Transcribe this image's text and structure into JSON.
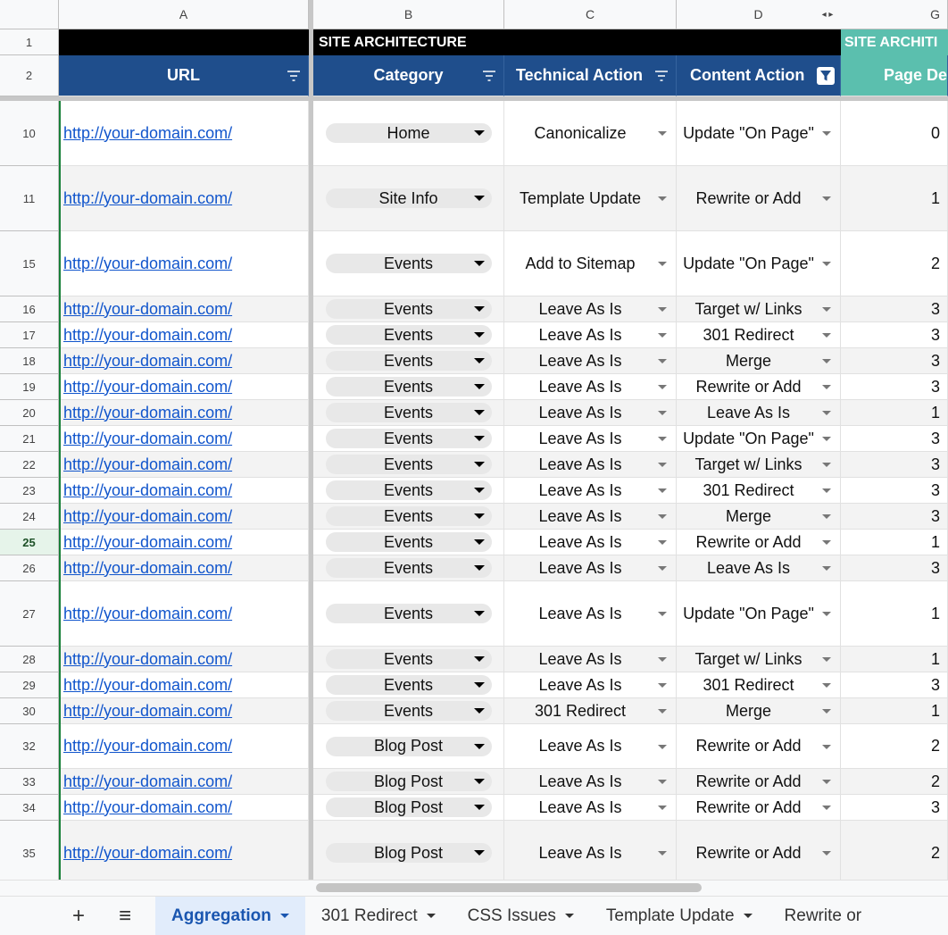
{
  "colors": {
    "header_blue": "#1f4e8c",
    "header_teal": "#5bbfae",
    "band_black": "#000000",
    "link": "#1155cc",
    "active_tab_bg": "#e1ecfb"
  },
  "columns": {
    "row_corner": "",
    "A": "A",
    "B": "B",
    "C": "C",
    "D": "D",
    "G": "G",
    "scroll_left": "◂",
    "scroll_right": "▸"
  },
  "band": {
    "row": "1",
    "label1": "SITE ARCHITECTURE",
    "label2": "SITE ARCHITI"
  },
  "headers": {
    "row": "2",
    "url": "URL",
    "category": "Category",
    "technical": "Technical Action",
    "content": "Content Action",
    "depth": "Page De"
  },
  "rows": [
    {
      "n": "10",
      "url": "http://your-domain.com/",
      "category": "Home",
      "technical": "Canonicalize",
      "content": "Update \"On Page\"",
      "depth": "0",
      "tall": true
    },
    {
      "n": "11",
      "url": "http://your-domain.com/",
      "category": "Site Info",
      "technical": "Template Update",
      "content": "Rewrite or Add",
      "depth": "1",
      "tall": true
    },
    {
      "n": "15",
      "url": "http://your-domain.com/",
      "category": "Events",
      "technical": "Add to Sitemap",
      "content": "Update \"On Page\"",
      "depth": "2",
      "tall": true
    },
    {
      "n": "16",
      "url": "http://your-domain.com/",
      "category": "Events",
      "technical": "Leave As Is",
      "content": "Target w/ Links",
      "depth": "3"
    },
    {
      "n": "17",
      "url": "http://your-domain.com/",
      "category": "Events",
      "technical": "Leave As Is",
      "content": "301 Redirect",
      "depth": "3"
    },
    {
      "n": "18",
      "url": "http://your-domain.com/",
      "category": "Events",
      "technical": "Leave As Is",
      "content": "Merge",
      "depth": "3"
    },
    {
      "n": "19",
      "url": "http://your-domain.com/",
      "category": "Events",
      "technical": "Leave As Is",
      "content": "Rewrite or Add",
      "depth": "3"
    },
    {
      "n": "20",
      "url": "http://your-domain.com/",
      "category": "Events",
      "technical": "Leave As Is",
      "content": "Leave As Is",
      "depth": "1"
    },
    {
      "n": "21",
      "url": "http://your-domain.com/",
      "category": "Events",
      "technical": "Leave As Is",
      "content": "Update \"On Page\"",
      "depth": "3"
    },
    {
      "n": "22",
      "url": "http://your-domain.com/",
      "category": "Events",
      "technical": "Leave As Is",
      "content": "Target w/ Links",
      "depth": "3"
    },
    {
      "n": "23",
      "url": "http://your-domain.com/",
      "category": "Events",
      "technical": "Leave As Is",
      "content": "301 Redirect",
      "depth": "3"
    },
    {
      "n": "24",
      "url": "http://your-domain.com/",
      "category": "Events",
      "technical": "Leave As Is",
      "content": "Merge",
      "depth": "3"
    },
    {
      "n": "25",
      "url": "http://your-domain.com/",
      "category": "Events",
      "technical": "Leave As Is",
      "content": "Rewrite or Add",
      "depth": "1",
      "active": true
    },
    {
      "n": "26",
      "url": "http://your-domain.com/",
      "category": "Events",
      "technical": "Leave As Is",
      "content": "Leave As Is",
      "depth": "3"
    },
    {
      "n": "27",
      "url": "http://your-domain.com/",
      "category": "Events",
      "technical": "Leave As Is",
      "content": "Update \"On Page\"",
      "depth": "1",
      "tall": true
    },
    {
      "n": "28",
      "url": "http://your-domain.com/",
      "category": "Events",
      "technical": "Leave As Is",
      "content": "Target w/ Links",
      "depth": "1"
    },
    {
      "n": "29",
      "url": "http://your-domain.com/",
      "category": "Events",
      "technical": "Leave As Is",
      "content": "301 Redirect",
      "depth": "3"
    },
    {
      "n": "30",
      "url": "http://your-domain.com/",
      "category": "Events",
      "technical": "301 Redirect",
      "content": "Merge",
      "depth": "1"
    },
    {
      "n": "32",
      "url": "http://your-domain.com/",
      "category": "Blog Post",
      "technical": "Leave As Is",
      "content": "Rewrite or Add",
      "depth": "2",
      "medium": true
    },
    {
      "n": "33",
      "url": "http://your-domain.com/",
      "category": "Blog Post",
      "technical": "Leave As Is",
      "content": "Rewrite or Add",
      "depth": "2"
    },
    {
      "n": "34",
      "url": "http://your-domain.com/",
      "category": "Blog Post",
      "technical": "Leave As Is",
      "content": "Rewrite or Add",
      "depth": "3"
    },
    {
      "n": "35",
      "url": "http://your-domain.com/",
      "category": "Blog Post",
      "technical": "Leave As Is",
      "content": "Rewrite or Add",
      "depth": "2",
      "tall": true
    }
  ],
  "tabs": {
    "add": "+",
    "list": "≡",
    "items": [
      "Aggregation",
      "301 Redirect",
      "CSS Issues",
      "Template Update",
      "Rewrite or"
    ],
    "active": 0
  }
}
